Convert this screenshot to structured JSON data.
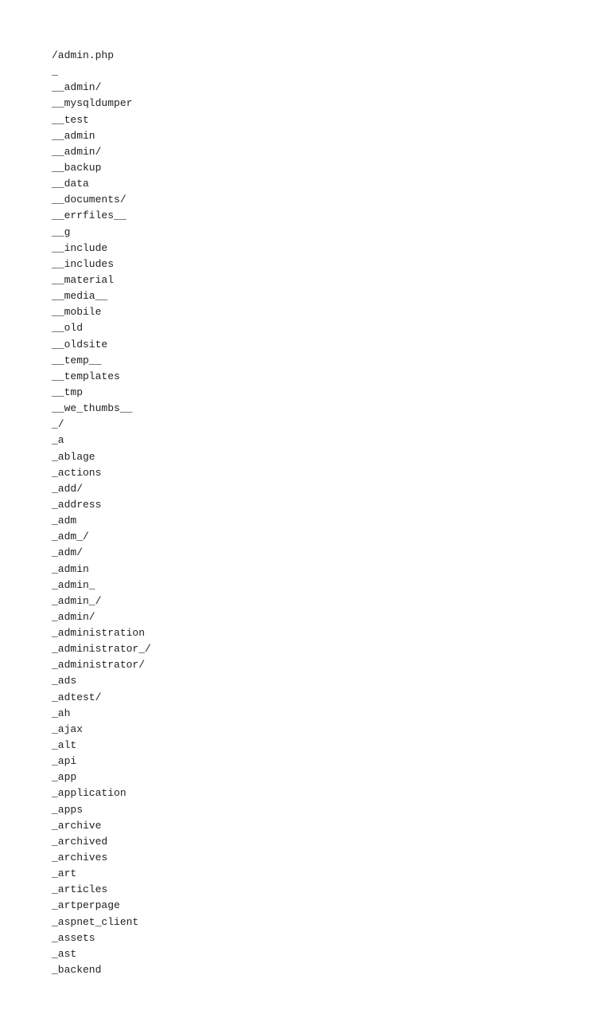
{
  "filelist": {
    "items": [
      "/admin.php",
      "_",
      "__admin/",
      "__mysqldumper",
      "__test",
      "__admin",
      "__admin/",
      "__backup",
      "__data",
      "__documents/",
      "__errfiles__",
      "__g",
      "__include",
      "__includes",
      "__material",
      "__media__",
      "__mobile",
      "__old",
      "__oldsite",
      "__temp__",
      "__templates",
      "__tmp",
      "__we_thumbs__",
      "_/",
      "_a",
      "_ablage",
      "_actions",
      "_add/",
      "_address",
      "_adm",
      "_adm_/",
      "_adm/",
      "_admin",
      "_admin_",
      "_admin_/",
      "_admin/",
      "_administration",
      "_administrator_/",
      "_administrator/",
      "_ads",
      "_adtest/",
      "_ah",
      "_ajax",
      "_alt",
      "_api",
      "_app",
      "_application",
      "_apps",
      "_archive",
      "_archived",
      "_archives",
      "_art",
      "_articles",
      "_artperpage",
      "_aspnet_client",
      "_assets",
      "_ast",
      "_backend"
    ]
  }
}
